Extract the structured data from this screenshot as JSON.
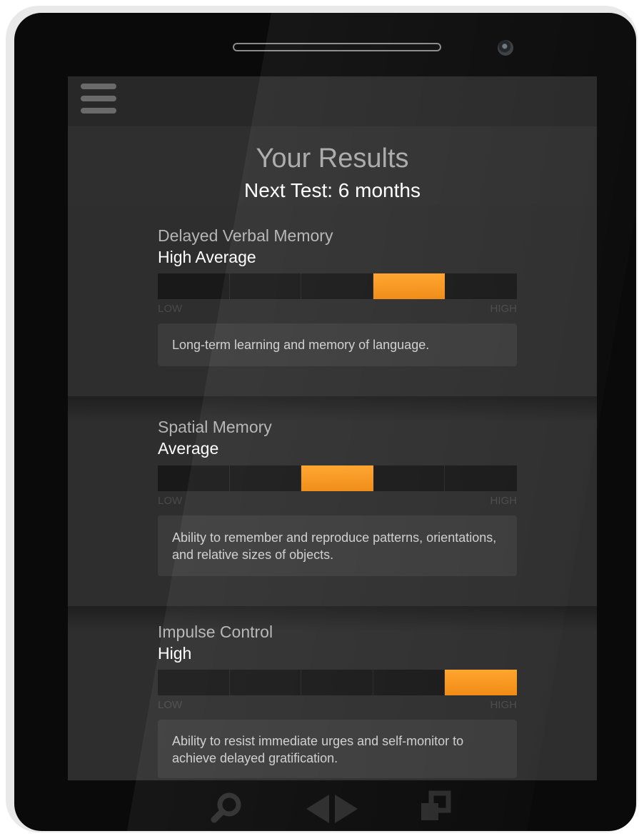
{
  "header": {
    "title": "Your Results",
    "subtitle": "Next Test: 6 months"
  },
  "scale": {
    "low": "LOW",
    "high": "HIGH"
  },
  "metrics": [
    {
      "name": "Delayed Verbal Memory",
      "level": "High Average",
      "segment": 4,
      "segments": 5,
      "description": "Long-term learning and memory of language."
    },
    {
      "name": "Spatial Memory",
      "level": "Average",
      "segment": 3,
      "segments": 5,
      "description": "Ability to remember and reproduce patterns, orientations, and relative sizes of objects."
    },
    {
      "name": "Impulse Control",
      "level": "High",
      "segment": 5,
      "segments": 5,
      "description": "Ability to resist immediate urges and self-monitor to achieve delayed gratification."
    }
  ],
  "nav": {
    "icons": [
      "search-icon",
      "back-forward-icon",
      "recent-apps-icon"
    ]
  },
  "colors": {
    "accent": "#f7941d",
    "background": "#2f2f2f",
    "bar_track": "#191919"
  }
}
